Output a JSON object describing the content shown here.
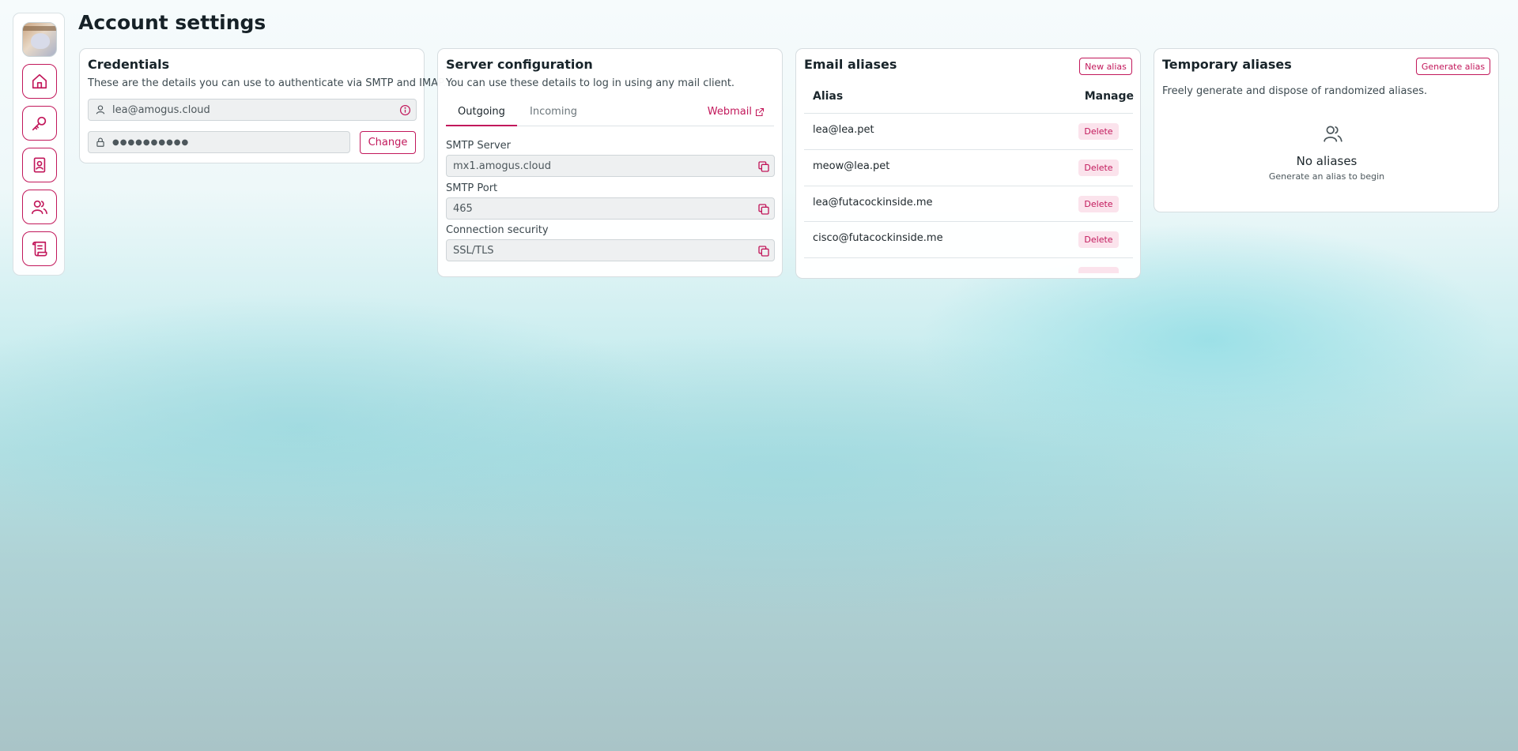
{
  "page": {
    "title": "Account settings"
  },
  "sidebar": {
    "items": [
      {
        "name": "home",
        "icon": "home-icon"
      },
      {
        "name": "keys",
        "icon": "key-icon"
      },
      {
        "name": "contacts",
        "icon": "contact-book-icon"
      },
      {
        "name": "users",
        "icon": "users-icon"
      },
      {
        "name": "logs",
        "icon": "scroll-icon"
      }
    ]
  },
  "credentials": {
    "title": "Credentials",
    "description": "These are the details you can use to authenticate via SMTP and IMAP.",
    "email": "lea@amogus.cloud",
    "password_mask": "●●●●●●●●●●",
    "change_label": "Change"
  },
  "server": {
    "title": "Server configuration",
    "description": "You can use these details to log in using any mail client.",
    "tabs": [
      {
        "label": "Outgoing",
        "active": true
      },
      {
        "label": "Incoming",
        "active": false
      }
    ],
    "webmail_label": "Webmail",
    "fields": [
      {
        "label": "SMTP Server",
        "value": "mx1.amogus.cloud"
      },
      {
        "label": "SMTP Port",
        "value": "465"
      },
      {
        "label": "Connection security",
        "value": "SSL/TLS"
      }
    ]
  },
  "aliases": {
    "title": "Email aliases",
    "new_label": "New alias",
    "col_alias": "Alias",
    "col_manage": "Manage",
    "delete_label": "Delete",
    "rows": [
      "lea@lea.pet",
      "meow@lea.pet",
      "lea@futacockinside.me",
      "cisco@futacockinside.me"
    ]
  },
  "temporary": {
    "title": "Temporary aliases",
    "generate_label": "Generate alias",
    "description": "Freely generate and dispose of randomized aliases.",
    "empty_title": "No aliases",
    "empty_subtitle": "Generate an alias to begin"
  },
  "colors": {
    "accent": "#c2185b",
    "delete_bg": "#fbe3ec"
  }
}
